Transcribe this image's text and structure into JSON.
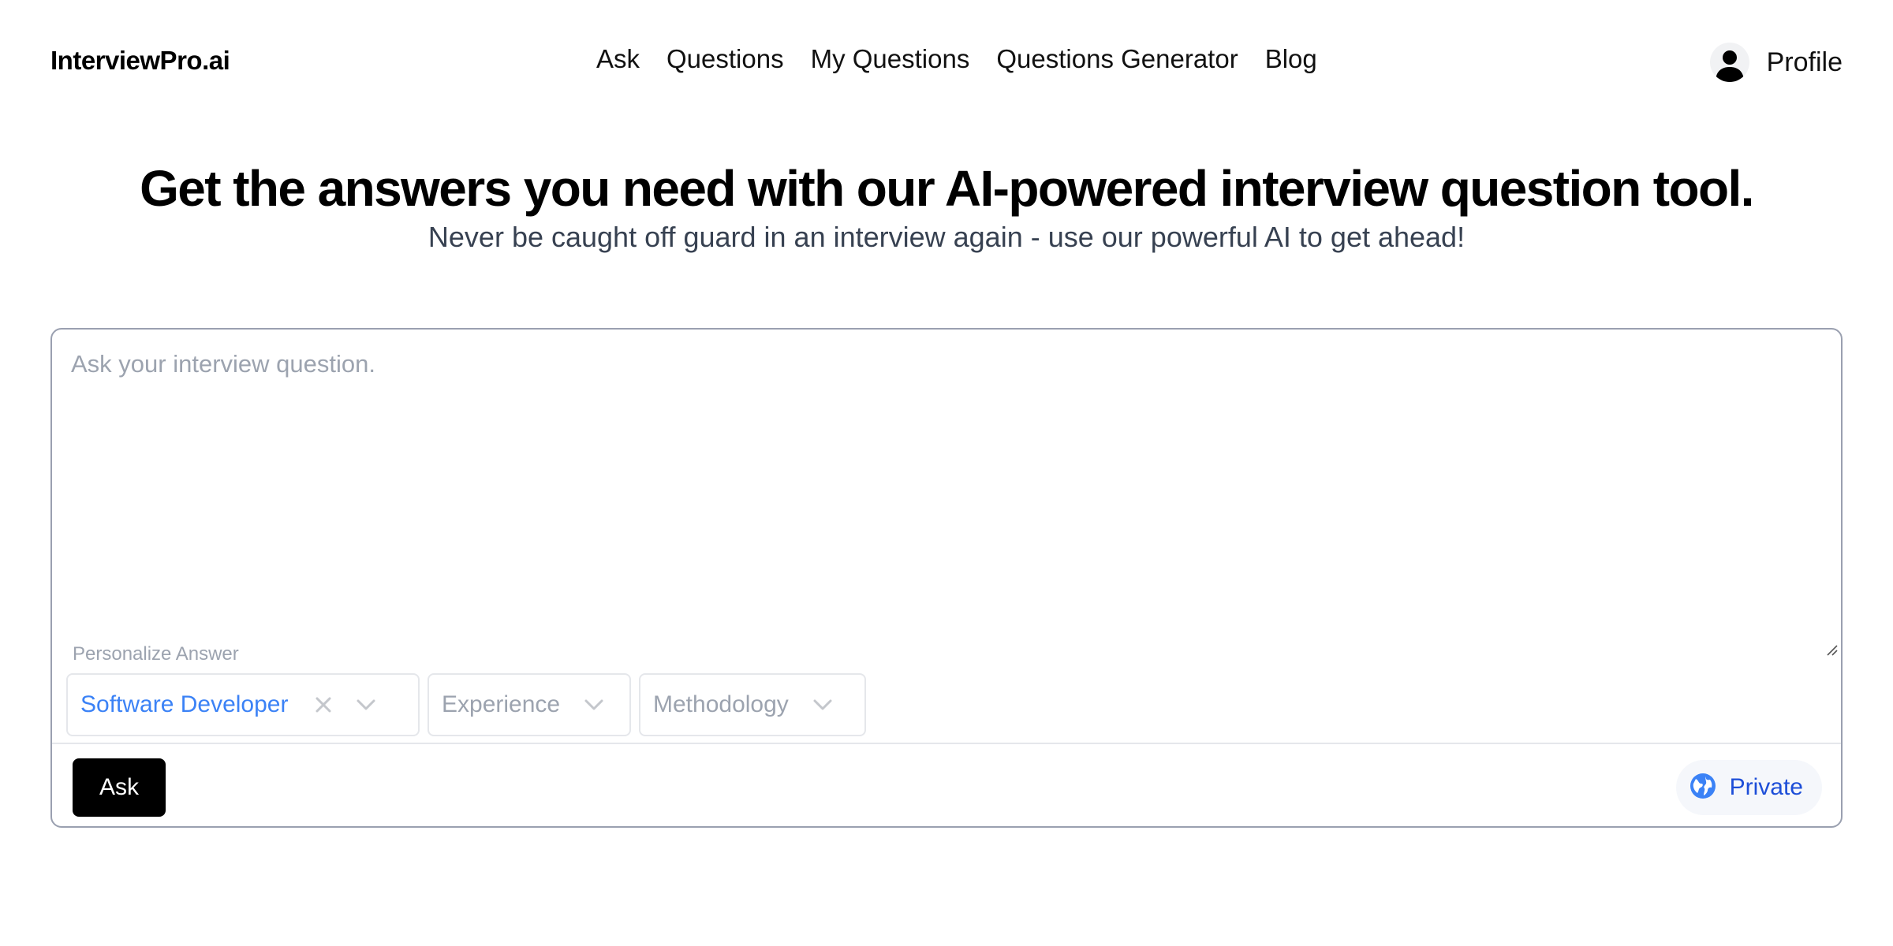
{
  "header": {
    "brand": "InterviewPro.ai",
    "nav": [
      "Ask",
      "Questions",
      "My Questions",
      "Questions Generator",
      "Blog"
    ],
    "profile_label": "Profile"
  },
  "hero": {
    "title": "Get the answers you need with our AI-powered interview question tool.",
    "subtitle": "Never be caught off guard in an interview again - use our powerful AI to get ahead!"
  },
  "question_form": {
    "placeholder": "Ask your interview question.",
    "value": "",
    "personalize_label": "Personalize Answer",
    "role_select": {
      "value": "Software Developer"
    },
    "experience_select": {
      "placeholder": "Experience"
    },
    "methodology_select": {
      "placeholder": "Methodology"
    },
    "ask_label": "Ask",
    "visibility_label": "Private"
  },
  "colors": {
    "accent_blue": "#3b82f6",
    "private_blue": "#1d4ed8",
    "placeholder_gray": "#9ca3af",
    "button_black": "#000000"
  }
}
